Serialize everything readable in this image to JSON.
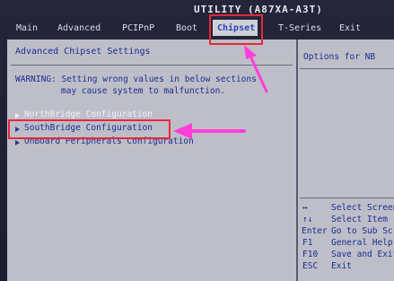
{
  "title": {
    "part1": "UTILITY",
    "part2": "(A87XA-A3T)"
  },
  "menu": {
    "items": [
      "Main",
      "Advanced",
      "PCIPnP",
      "Boot",
      "Chipset",
      "T-Series",
      "Exit"
    ],
    "active": "Chipset"
  },
  "left_panel": {
    "heading": "Advanced Chipset Settings",
    "warning_line1": "WARNING: Setting wrong values in below sections",
    "warning_line2": "may cause system to malfunction.",
    "entries": [
      "NorthBridge Configuration",
      "SouthBridge Configuration",
      "OnBoard Peripherals Configuration"
    ],
    "selected_entry": "SouthBridge Configuration"
  },
  "right_panel": {
    "help_title": "Options for NB",
    "keys": [
      {
        "key": "↔",
        "desc": "Select Screen"
      },
      {
        "key": "↑↓",
        "desc": "Select Item"
      },
      {
        "key": "Enter",
        "desc": "Go to Sub Scr"
      },
      {
        "key": "F1",
        "desc": "General Help"
      },
      {
        "key": "F10",
        "desc": "Save and Exit"
      },
      {
        "key": "ESC",
        "desc": "Exit"
      }
    ]
  },
  "colors": {
    "annotation_red": "#e8283a",
    "annotation_pink": "#ff3fd8",
    "bios_grey": "#bebec8",
    "bios_frame": "#1d1d32",
    "bios_blue_text": "#1a2e90"
  }
}
